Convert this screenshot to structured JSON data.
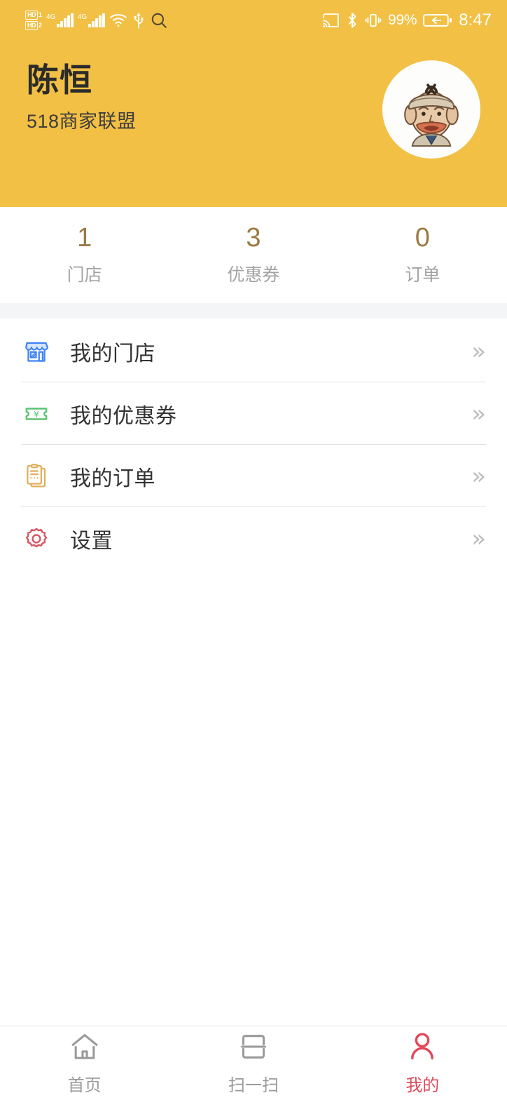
{
  "statusbar": {
    "hd1_label": "HD",
    "hd1_num": "1",
    "hd2_label": "HD",
    "hd2_num": "2",
    "network1": "4G",
    "network2": "4G",
    "wifi_icon": "wifi-icon",
    "usb_icon": "usb-icon",
    "search_icon": "search-icon",
    "cast_icon": "cast-icon",
    "bluetooth_icon": "bluetooth-icon",
    "vibrate_icon": "vibrate-icon",
    "battery_percent": "99%",
    "battery_icon": "battery-charging-icon",
    "time": "8:47"
  },
  "header": {
    "user_name": "陈恒",
    "alliance": "518商家联盟",
    "avatar_icon": "user-avatar",
    "background_color": "#f2c044"
  },
  "stats": [
    {
      "value": "1",
      "label": "门店"
    },
    {
      "value": "3",
      "label": "优惠券"
    },
    {
      "value": "0",
      "label": "订单"
    }
  ],
  "menu": [
    {
      "label": "我的门店",
      "icon": "store-icon",
      "color": "#3e83f8",
      "arrow": "»"
    },
    {
      "label": "我的优惠券",
      "icon": "coupon-icon",
      "color": "#5dc472",
      "arrow": "»"
    },
    {
      "label": "我的订单",
      "icon": "clipboard-icon",
      "color": "#e0ae5a",
      "arrow": "»"
    },
    {
      "label": "设置",
      "icon": "gear-icon",
      "color": "#d65763",
      "arrow": "»"
    }
  ],
  "bottom_nav": [
    {
      "label": "首页",
      "icon": "home-icon",
      "active": false
    },
    {
      "label": "扫一扫",
      "icon": "scan-icon",
      "active": false
    },
    {
      "label": "我的",
      "icon": "person-icon",
      "active": true
    }
  ],
  "colors": {
    "brand_yellow": "#f2c044",
    "accent_red": "#e0495a",
    "stat_number": "#9b7b43"
  }
}
